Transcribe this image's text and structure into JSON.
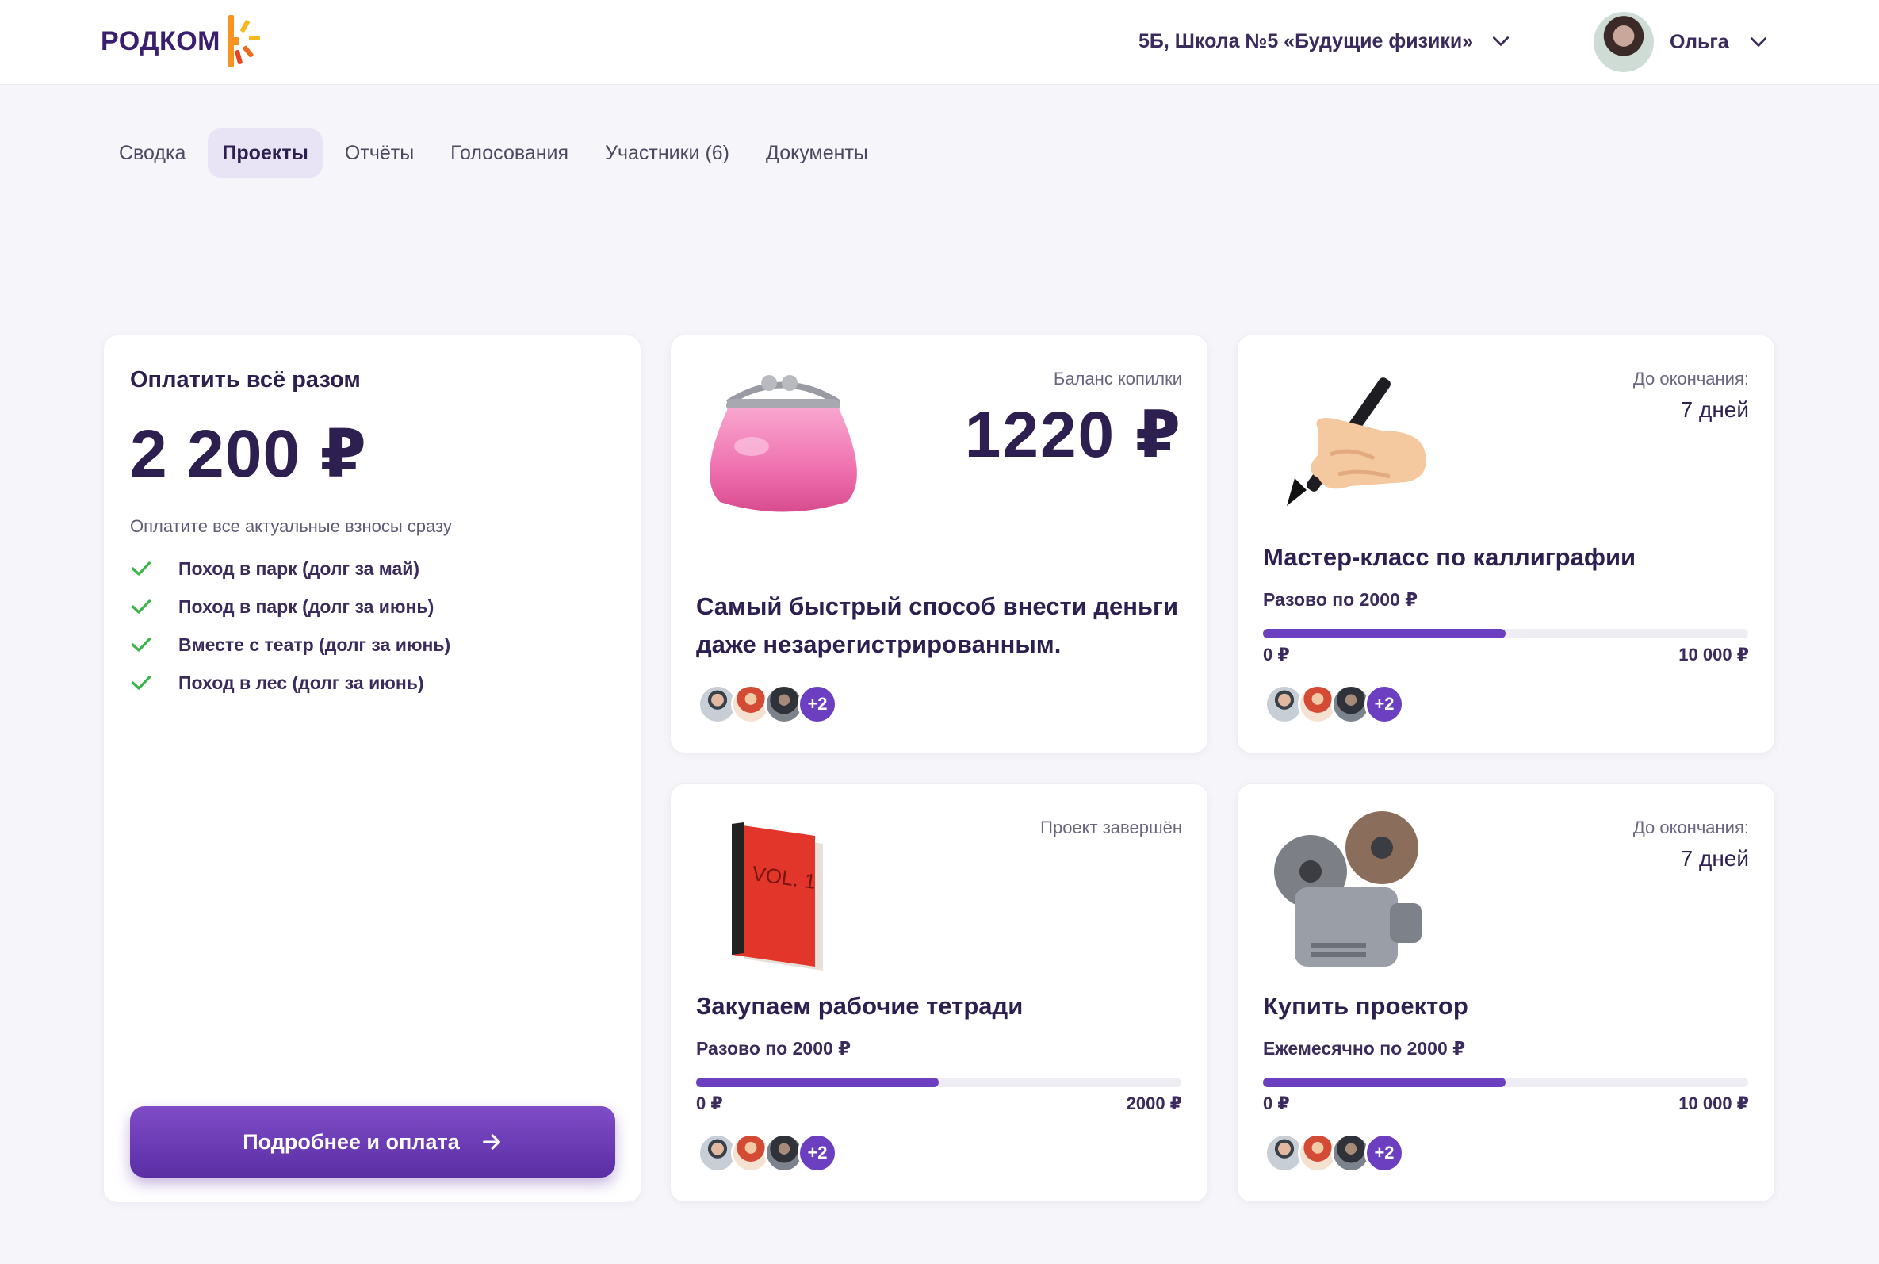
{
  "header": {
    "logo_text": "РОДКОМ",
    "school": "5Б, Школа №5 «Будущие физики»",
    "user_name": "Ольга"
  },
  "tabs": [
    {
      "label": "Сводка",
      "active": false
    },
    {
      "label": "Проекты",
      "active": true
    },
    {
      "label": "Отчёты",
      "active": false
    },
    {
      "label": "Голосования",
      "active": false
    },
    {
      "label": "Участники (6)",
      "active": false
    },
    {
      "label": "Документы",
      "active": false
    }
  ],
  "pay_all": {
    "title": "Оплатить всё разом",
    "amount": "2 200 ₽",
    "subtitle": "Оплатите все актуальные взносы сразу",
    "items": [
      "Поход в парк (долг за май)",
      "Поход в парк (долг за июнь)",
      "Вместе с театр (долг за июнь)",
      "Поход в лес (долг за июнь)"
    ],
    "button_label": "Подробнее и оплата"
  },
  "cards": {
    "piggy": {
      "label": "Баланс копилки",
      "balance": "1220 ₽",
      "description": "Самый быстрый способ внести деньги даже незарегистрированным.",
      "icon": "purse-icon",
      "more": "+2"
    },
    "calligraphy": {
      "label": "До окончания:",
      "deadline": "7 дней",
      "title": "Мастер-класс по каллиграфии",
      "frequency": "Разово по 2000 ₽",
      "progress": 0.5,
      "min": "0 ₽",
      "max": "10 000 ₽",
      "icon": "writing-hand-icon",
      "more": "+2"
    },
    "notebooks": {
      "label": "Проект завершён",
      "title": "Закупаем рабочие тетради",
      "frequency": "Разово по 2000 ₽",
      "progress": 0.5,
      "min": "0 ₽",
      "max": "2000 ₽",
      "icon": "book-icon",
      "book_text": "VOL. 1",
      "more": "+2"
    },
    "projector": {
      "label": "До окончания:",
      "deadline": "7 дней",
      "title": "Купить проектор",
      "frequency": "Ежемесячно по 2000 ₽",
      "progress": 0.5,
      "min": "0 ₽",
      "max": "10 000 ₽",
      "icon": "film-projector-icon",
      "more": "+2"
    }
  },
  "colors": {
    "accent": "#6b3fc0",
    "text_dark": "#2d1f4f",
    "check_green": "#3bb54a",
    "logo_orange": "#f7931e"
  }
}
